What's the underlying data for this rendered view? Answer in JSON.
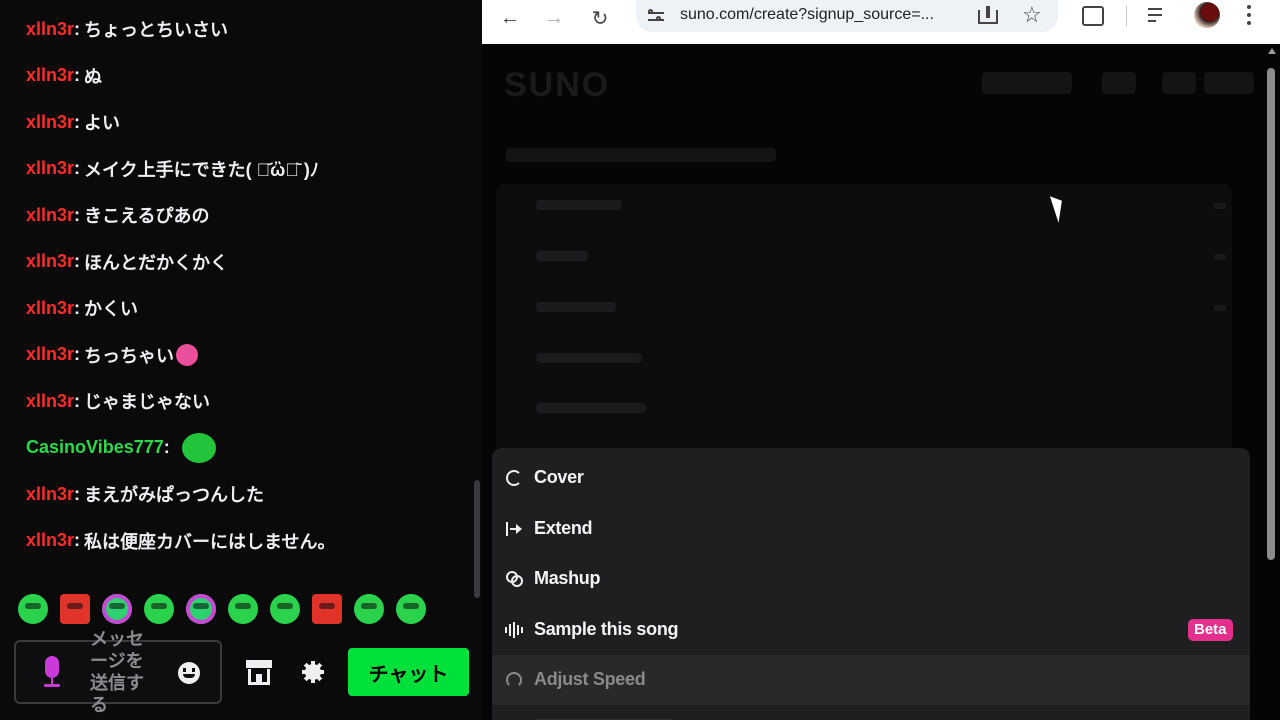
{
  "chat": {
    "messages": [
      {
        "user": "xlln3r",
        "text": "ちょっとちいさい",
        "user_color": "#ff2b2b"
      },
      {
        "user": "xlln3r",
        "text": "ぬ",
        "user_color": "#ff2b2b"
      },
      {
        "user": "xlln3r",
        "text": "よい",
        "user_color": "#ff2b2b"
      },
      {
        "user": "xlln3r",
        "text": "メイク上手にできた( ･᷄ὢ･᷅ )ﾉ",
        "user_color": "#ff2b2b"
      },
      {
        "user": "xlln3r",
        "text": "きこえるぴあの",
        "user_color": "#ff2b2b"
      },
      {
        "user": "xlln3r",
        "text": "ほんとだかくかく",
        "user_color": "#ff2b2b"
      },
      {
        "user": "xlln3r",
        "text": "かくい",
        "user_color": "#ff2b2b"
      },
      {
        "user": "xlln3r",
        "text": "ちっちゃい",
        "user_color": "#ff2b2b",
        "emote": "crying-face-emote"
      },
      {
        "user": "xlln3r",
        "text": "じゃまじゃない",
        "user_color": "#ff2b2b"
      },
      {
        "user": "CasinoVibes777",
        "text": "",
        "user_color": "#2bd94a",
        "emote": "green-blob-emote"
      },
      {
        "user": "xlln3r",
        "text": "まえがみぱっつんした",
        "user_color": "#ff2b2b"
      },
      {
        "user": "xlln3r",
        "text": "私は便座カバーにはしません。",
        "user_color": "#ff2b2b"
      }
    ],
    "separator": ":",
    "input_placeholder": "メッセージを送信する",
    "send_label": "チャット",
    "accent_color": "#00e03a"
  },
  "browser": {
    "url": "suno.com/create?signup_source=...",
    "menu": [
      {
        "label": "Cover",
        "icon": "cover-icon",
        "disabled": false
      },
      {
        "label": "Extend",
        "icon": "extend-icon",
        "disabled": false
      },
      {
        "label": "Mashup",
        "icon": "mashup-icon",
        "disabled": false
      },
      {
        "label": "Sample this song",
        "icon": "sample-icon",
        "disabled": false,
        "badge": "Beta"
      },
      {
        "label": "Adjust Speed",
        "icon": "speed-icon",
        "disabled": true
      }
    ],
    "badge_color": "#e4308c"
  }
}
